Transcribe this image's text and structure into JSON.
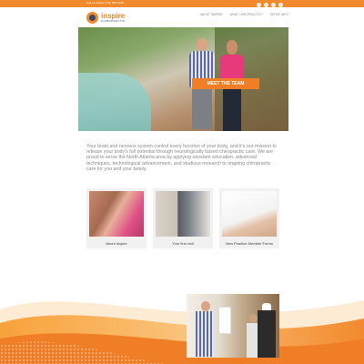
{
  "topbar": {
    "text": "Call Us Today! (770) 555-7246"
  },
  "header": {
    "logo_name": "inspire",
    "logo_sub": "CHIROPRACTIC",
    "nav": [
      {
        "label": "About Inspire"
      },
      {
        "label": "What Chiropractic?"
      },
      {
        "label": "Office Info"
      }
    ],
    "social_icons": [
      "facebook-icon",
      "twitter-icon",
      "google-plus-icon",
      "youtube-icon"
    ]
  },
  "hero": {
    "button_label": "MEET THE TEAM"
  },
  "intro": {
    "text": "Your brain and nervous system control every function of your body, and it's our mission to release your body's full potential through neurologically based chiropractic care. We are proud to serve the North Atlanta area by applying constant education, advanced techniques, technological advancement, and studious research to ongoing chiropractic care for you and your family."
  },
  "cards": [
    {
      "label": "About Inspire"
    },
    {
      "label": "Your first visit"
    },
    {
      "label": "New Practice Member Forms"
    }
  ],
  "colors": {
    "accent": "#f08a2c",
    "brand_dark": "#3b4a6b",
    "text": "#8a8a8a"
  }
}
